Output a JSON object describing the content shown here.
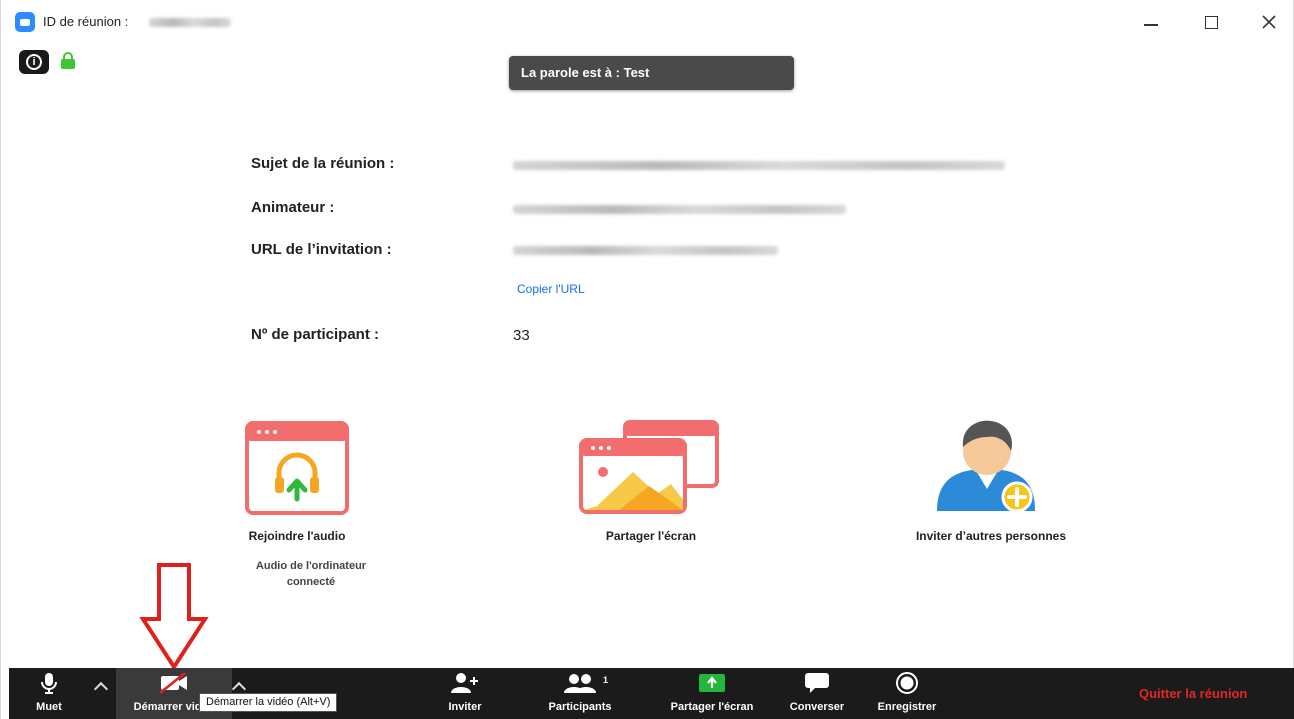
{
  "window": {
    "title": "ID de réunion :",
    "controls": [
      "minimize",
      "maximize",
      "close"
    ]
  },
  "speaker_banner": "La parole est à : Test",
  "meeting_info": {
    "subject_label": "Sujet de la réunion :",
    "host_label": "Animateur :",
    "url_label": "URL de l’invitation :",
    "copy_url": "Copier l'URL",
    "participant_label": "Nº de participant :",
    "participant_value": "33"
  },
  "actions": {
    "join_audio": {
      "label": "Rejoindre l'audio",
      "sub_line1": "Audio de l'ordinateur",
      "sub_line2": "connecté"
    },
    "share_screen": {
      "label": "Partager l'écran"
    },
    "invite": {
      "label": "Inviter d’autres personnes"
    }
  },
  "toolbar": {
    "mute": "Muet",
    "start_video": "Démarrer vidéo",
    "invite": "Inviter",
    "participants": "Participants",
    "participants_count": "1",
    "share_screen": "Partager l'écran",
    "chat": "Converser",
    "record": "Enregistrer",
    "quit": "Quitter la réunion"
  },
  "tooltip": "Démarrer la vidéo (Alt+V)",
  "colors": {
    "accent_blue": "#0e71eb",
    "tile_red": "#f26d6d",
    "share_green": "#25b73d",
    "quit_red": "#e02828",
    "toolbar_bg": "#1b1b1b"
  }
}
